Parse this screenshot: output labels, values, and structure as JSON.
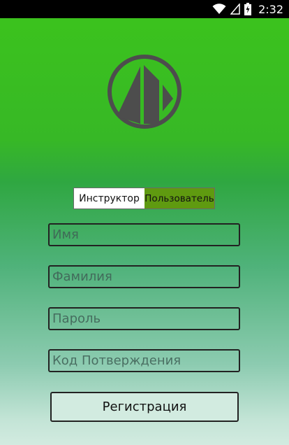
{
  "status_bar": {
    "time": "2:32",
    "icons": [
      "wifi-icon",
      "signal-icon",
      "battery-icon"
    ]
  },
  "logo": {
    "icon": "mountain-logo-icon",
    "color": "#4d4d4d"
  },
  "role_toggle": {
    "options": [
      "Инструктор",
      "Пользователь"
    ],
    "selected": "Пользователь",
    "selected_color": "#5f9a10"
  },
  "form": {
    "first_name_placeholder": "Имя",
    "last_name_placeholder": "Фамилия",
    "password_placeholder": "Пароль",
    "confirmation_code_placeholder": "Код Потверждения"
  },
  "register_button": {
    "label": "Регистрация"
  },
  "colors": {
    "top": "#3cc41c",
    "bottom": "#d2ebe0"
  }
}
